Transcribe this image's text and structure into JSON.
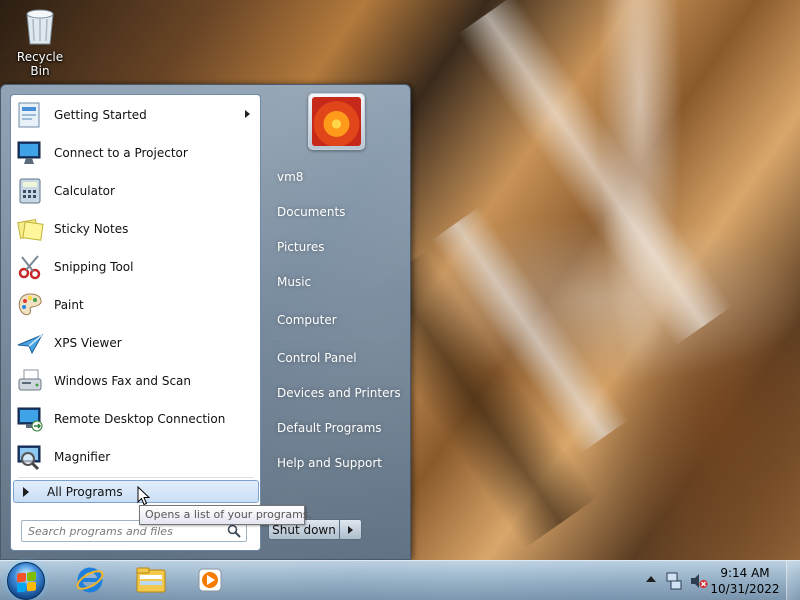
{
  "desktop": {
    "recycle_bin_label": "Recycle Bin"
  },
  "start_menu": {
    "programs": [
      {
        "label": "Getting Started",
        "icon": "getting-started-icon",
        "has_submenu": true
      },
      {
        "label": "Connect to a Projector",
        "icon": "projector-icon"
      },
      {
        "label": "Calculator",
        "icon": "calculator-icon"
      },
      {
        "label": "Sticky Notes",
        "icon": "sticky-notes-icon"
      },
      {
        "label": "Snipping Tool",
        "icon": "snipping-tool-icon"
      },
      {
        "label": "Paint",
        "icon": "paint-icon"
      },
      {
        "label": "XPS Viewer",
        "icon": "xps-viewer-icon"
      },
      {
        "label": "Windows Fax and Scan",
        "icon": "fax-scan-icon"
      },
      {
        "label": "Remote Desktop Connection",
        "icon": "remote-desktop-icon"
      },
      {
        "label": "Magnifier",
        "icon": "magnifier-icon"
      }
    ],
    "all_programs_label": "All Programs",
    "search_placeholder": "Search programs and files",
    "right_items": [
      {
        "label": "vm8"
      },
      {
        "label": "Documents"
      },
      {
        "label": "Pictures"
      },
      {
        "label": "Music"
      },
      {
        "label": "Computer"
      },
      {
        "label": "Control Panel"
      },
      {
        "label": "Devices and Printers"
      },
      {
        "label": "Default Programs"
      },
      {
        "label": "Help and Support"
      }
    ],
    "shutdown_label": "Shut down",
    "tooltip": "Opens a list of your programs."
  },
  "taskbar": {
    "pinned": [
      "internet-explorer-icon",
      "windows-explorer-icon",
      "media-player-icon"
    ],
    "clock": {
      "time": "9:14 AM",
      "date": "10/31/2022"
    }
  },
  "colors": {
    "start_menu_glass": "#8da4ba",
    "selection": "#c9def5",
    "taskbar": "#9bb8d2"
  }
}
